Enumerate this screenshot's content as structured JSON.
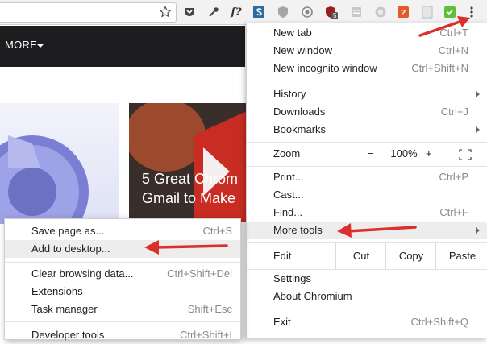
{
  "toolbar": {
    "icons": [
      "star-icon",
      "pocket-icon",
      "eyedropper-icon",
      "font-icon",
      "stylus-icon",
      "shield-icon",
      "tracker-icon",
      "ublock-icon",
      "page-icon",
      "chromecast-icon",
      "honey-icon",
      "evernote-icon",
      "kebab-menu-icon"
    ],
    "font_icon_text": "f?",
    "ublock_badge": "5"
  },
  "page": {
    "nav_more": "MORE",
    "headline_line1": "5 Great Chrom",
    "headline_line2": "Gmail to Make"
  },
  "menu": {
    "new_tab": {
      "label": "New tab",
      "shortcut": "Ctrl+T"
    },
    "new_window": {
      "label": "New window",
      "shortcut": "Ctrl+N"
    },
    "new_incognito": {
      "label": "New incognito window",
      "shortcut": "Ctrl+Shift+N"
    },
    "history": {
      "label": "History"
    },
    "downloads": {
      "label": "Downloads",
      "shortcut": "Ctrl+J"
    },
    "bookmarks": {
      "label": "Bookmarks"
    },
    "zoom": {
      "label": "Zoom",
      "minus": "−",
      "value": "100%",
      "plus": "+"
    },
    "print": {
      "label": "Print...",
      "shortcut": "Ctrl+P"
    },
    "cast": {
      "label": "Cast..."
    },
    "find": {
      "label": "Find...",
      "shortcut": "Ctrl+F"
    },
    "more_tools": {
      "label": "More tools"
    },
    "edit": {
      "label": "Edit",
      "cut": "Cut",
      "copy": "Copy",
      "paste": "Paste"
    },
    "settings": {
      "label": "Settings"
    },
    "about": {
      "label": "About Chromium"
    },
    "exit": {
      "label": "Exit",
      "shortcut": "Ctrl+Shift+Q"
    }
  },
  "submenu": {
    "save_page": {
      "label": "Save page as...",
      "shortcut": "Ctrl+S"
    },
    "add_desktop": {
      "label": "Add to desktop..."
    },
    "clear_data": {
      "label": "Clear browsing data...",
      "shortcut": "Ctrl+Shift+Del"
    },
    "extensions": {
      "label": "Extensions"
    },
    "task_manager": {
      "label": "Task manager",
      "shortcut": "Shift+Esc"
    },
    "developer_tools": {
      "label": "Developer tools",
      "shortcut": "Ctrl+Shift+I"
    }
  },
  "colors": {
    "annotation_arrow": "#d9302b",
    "menu_highlight": "#ededed"
  }
}
